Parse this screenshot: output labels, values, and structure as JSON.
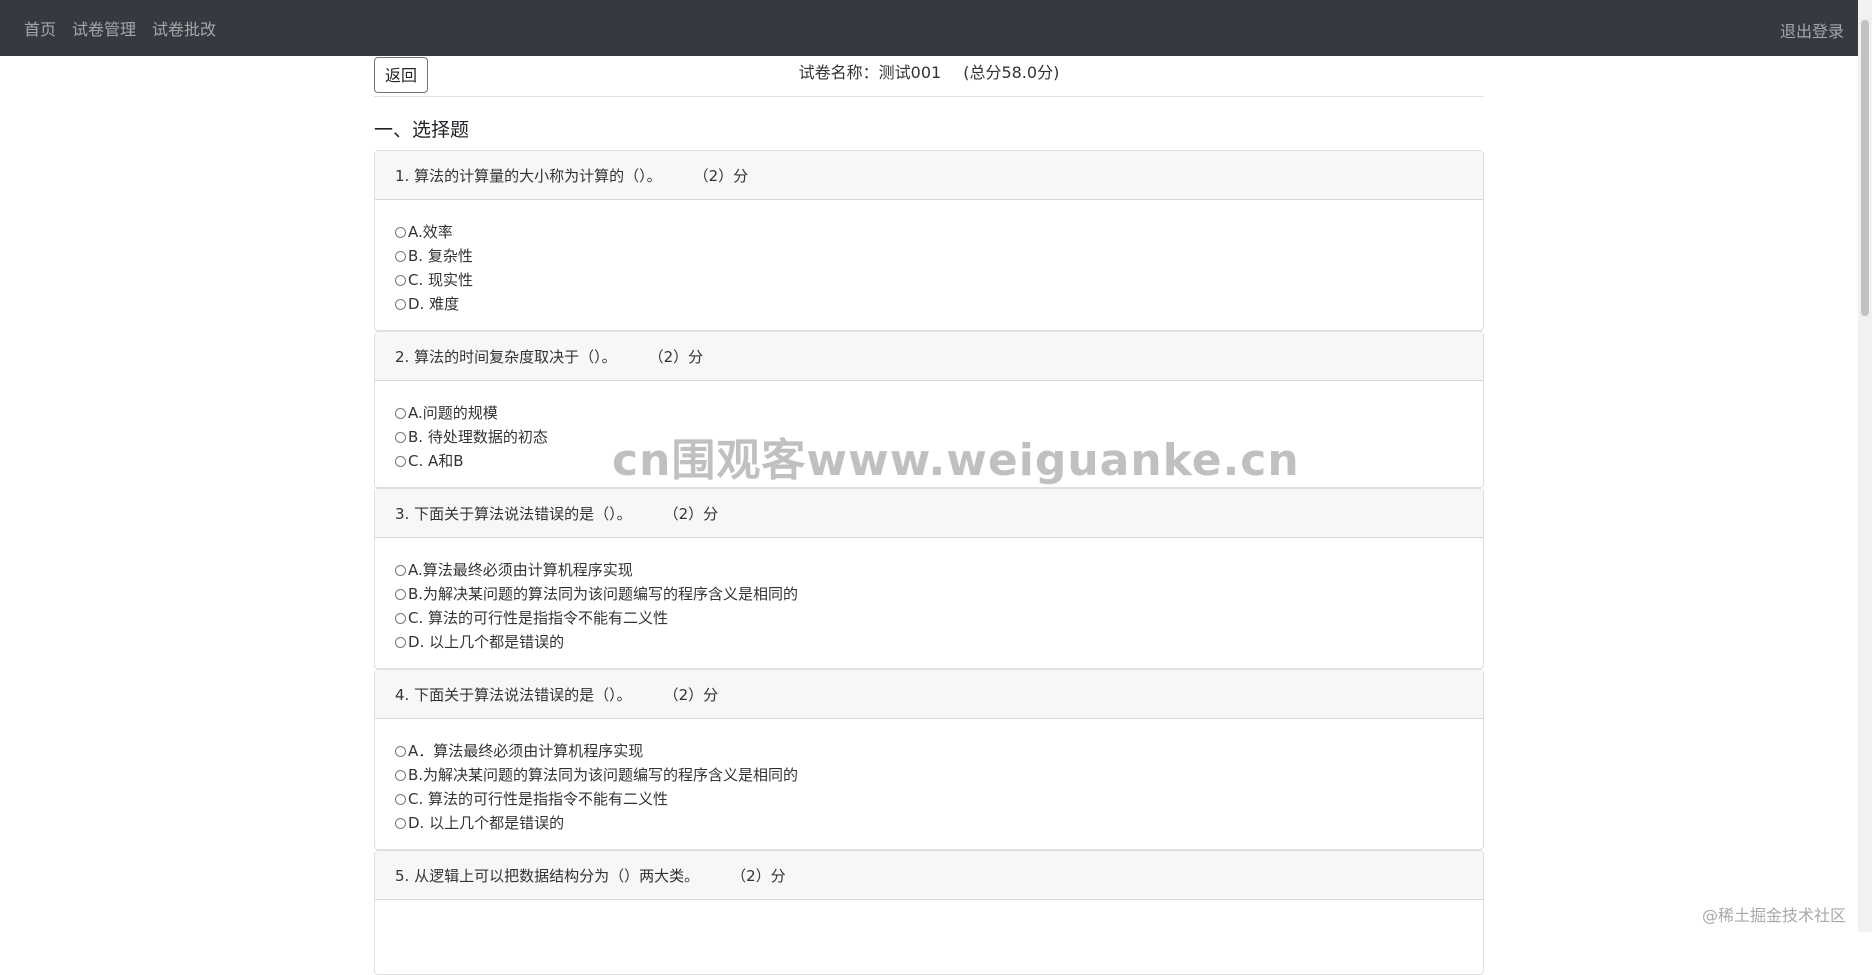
{
  "nav": {
    "links": [
      "首页",
      "试卷管理",
      "试卷批改"
    ],
    "logout": "退出登录"
  },
  "header": {
    "back_label": "返回",
    "paper_name": "试卷名称：测试001",
    "total_score": "(总分58.0分)"
  },
  "section": {
    "title": "一、选择题"
  },
  "questions": [
    {
      "title": "1. 算法的计算量的大小称为计算的（）。",
      "score": "（2）分",
      "options": [
        "A.效率",
        "B. 复杂性",
        "C. 现实性",
        "D. 难度"
      ]
    },
    {
      "title": "2. 算法的时间复杂度取决于（）。",
      "score": "（2）分",
      "options": [
        "A.问题的规模",
        "B. 待处理数据的初态",
        "C. A和B"
      ]
    },
    {
      "title": "3. 下面关于算法说法错误的是（）。",
      "score": "（2）分",
      "options": [
        "A.算法最终必须由计算机程序实现",
        "B.为解决某问题的算法同为该问题编写的程序含义是相同的",
        "C. 算法的可行性是指指令不能有二义性",
        "D. 以上几个都是错误的"
      ]
    },
    {
      "title": "4. 下面关于算法说法错误的是（）。",
      "score": "（2）分",
      "options": [
        "A．算法最终必须由计算机程序实现",
        "B.为解决某问题的算法同为该问题编写的程序含义是相同的",
        "C. 算法的可行性是指指令不能有二义性",
        "D. 以上几个都是错误的"
      ]
    },
    {
      "title": "5. 从逻辑上可以把数据结构分为（）两大类。",
      "score": "（2）分",
      "options": []
    }
  ],
  "watermark": "cn围观客www.weiguanke.cn",
  "corner_mark": "@稀土掘金技术社区"
}
